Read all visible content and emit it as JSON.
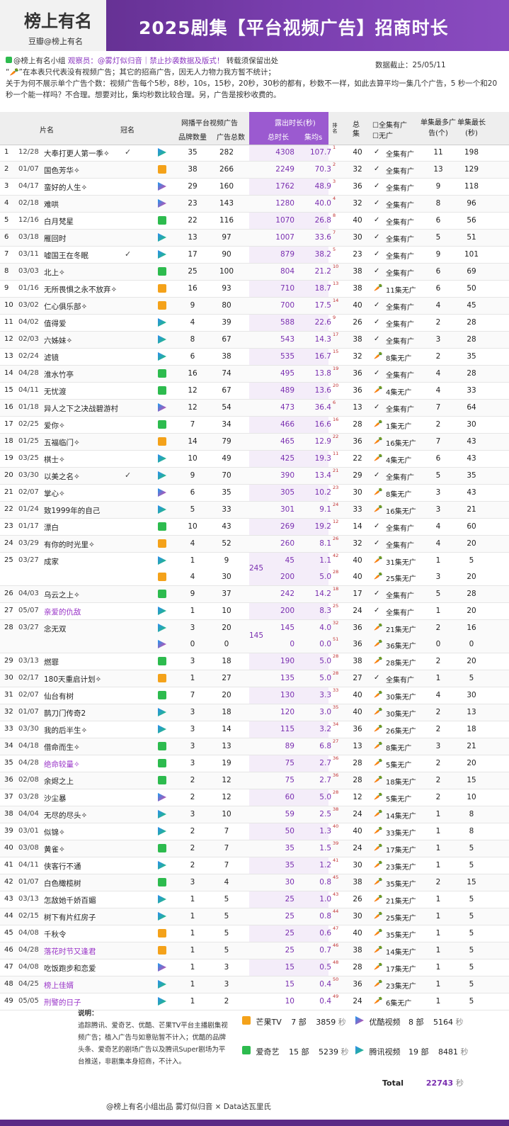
{
  "header": {
    "logo_text": "榜上有名",
    "logo_sub": "豆瓣@榜上有名",
    "title": "2025剧集【平台视频广告】招商时长"
  },
  "notes": {
    "line1_prefix": "@榜上有名小组",
    "line1_observer": "观察员：@雾灯似归音｜禁止抄袭数据及版式！",
    "line1_suffix": "转载须保留出处",
    "line2": "“🥕”在本表只代表没有视频广告；其它的招商广告，因无人力物力我方暂不统计；",
    "line3": "关于为何不展示单个广告个数：视频广告每个5秒，8秒，10s，15秒，20秒，30秒的都有，秒数不一样，如此去算平均一集几个广告，5 秒一个和20秒一个能一样吗？不合理。想要对比，集均秒数比较合理。另，广告是按秒收费的。",
    "date": "数据截止：25/05/11"
  },
  "table_header": {
    "name": "片名",
    "crown": "冠名",
    "platform_group": "网播平台视频广告",
    "brand_count": "品牌数量",
    "ad_total": "广告总数",
    "exposure_group": "露出时长(秒)",
    "total_len": "总时长",
    "avg_len": "集均s",
    "rank": "排名",
    "episodes": "总集",
    "full_ad": "☐全集有广",
    "no_ad": "☐无广",
    "max_per_ep": "单集最多广告(个)",
    "max_len": "单集最长(秒)"
  },
  "rows": [
    {
      "no": "1",
      "date": "12/28",
      "name": "大奉打更人第一季✧",
      "crown": "✓",
      "plat": "tencent",
      "brand": "35",
      "ads": "282",
      "total": "4308",
      "avg": "107.7",
      "rank": "1",
      "ep": "40",
      "chk": "✓",
      "status": "全集有广",
      "max": "11",
      "len": "198",
      "pur": false
    },
    {
      "no": "2",
      "date": "01/07",
      "name": "国色芳华✧",
      "crown": "",
      "plat": "mango",
      "brand": "38",
      "ads": "266",
      "total": "2249",
      "avg": "70.3",
      "rank": "2",
      "ep": "32",
      "chk": "✓",
      "status": "全集有广",
      "max": "13",
      "len": "129",
      "pur": false
    },
    {
      "no": "3",
      "date": "04/17",
      "name": "蛮好的人生✧",
      "crown": "",
      "plat": "youku",
      "brand": "29",
      "ads": "160",
      "total": "1762",
      "avg": "48.9",
      "rank": "3",
      "ep": "36",
      "chk": "✓",
      "status": "全集有广",
      "max": "9",
      "len": "118",
      "pur": false
    },
    {
      "no": "4",
      "date": "02/18",
      "name": "难哄",
      "crown": "",
      "plat": "youku",
      "brand": "23",
      "ads": "143",
      "total": "1280",
      "avg": "40.0",
      "rank": "4",
      "ep": "32",
      "chk": "✓",
      "status": "全集有广",
      "max": "8",
      "len": "96",
      "pur": false
    },
    {
      "no": "5",
      "date": "12/16",
      "name": "白月梵星",
      "crown": "",
      "plat": "iqiyi",
      "brand": "22",
      "ads": "116",
      "total": "1070",
      "avg": "26.8",
      "rank": "8",
      "ep": "40",
      "chk": "✓",
      "status": "全集有广",
      "max": "6",
      "len": "56",
      "pur": false
    },
    {
      "no": "6",
      "date": "03/18",
      "name": "雁回时",
      "crown": "",
      "plat": "tencent",
      "brand": "13",
      "ads": "97",
      "total": "1007",
      "avg": "33.6",
      "rank": "7",
      "ep": "30",
      "chk": "✓",
      "status": "全集有广",
      "max": "5",
      "len": "51",
      "pur": false
    },
    {
      "no": "7",
      "date": "03/11",
      "name": "嘘国王在冬眠",
      "crown": "✓",
      "plat": "tencent",
      "brand": "17",
      "ads": "90",
      "total": "879",
      "avg": "38.2",
      "rank": "5",
      "ep": "23",
      "chk": "✓",
      "status": "全集有广",
      "max": "9",
      "len": "101",
      "pur": false
    },
    {
      "no": "8",
      "date": "03/03",
      "name": "北上✧",
      "crown": "",
      "plat": "iqiyi",
      "brand": "25",
      "ads": "100",
      "total": "804",
      "avg": "21.2",
      "rank": "10",
      "ep": "38",
      "chk": "✓",
      "status": "全集有广",
      "max": "6",
      "len": "69",
      "pur": false
    },
    {
      "no": "9",
      "date": "01/16",
      "name": "无所畏惧之永不放弃✧",
      "crown": "",
      "plat": "mango",
      "brand": "16",
      "ads": "93",
      "total": "710",
      "avg": "18.7",
      "rank": "13",
      "ep": "38",
      "chk": "🥕",
      "status": "11集无广",
      "max": "6",
      "len": "50",
      "pur": false
    },
    {
      "no": "10",
      "date": "03/02",
      "name": "仁心俱乐部✧",
      "crown": "",
      "plat": "mango",
      "brand": "9",
      "ads": "80",
      "total": "700",
      "avg": "17.5",
      "rank": "14",
      "ep": "40",
      "chk": "✓",
      "status": "全集有广",
      "max": "4",
      "len": "45",
      "pur": false
    },
    {
      "no": "11",
      "date": "04/02",
      "name": "值得爱",
      "crown": "",
      "plat": "tencent",
      "brand": "4",
      "ads": "39",
      "total": "588",
      "avg": "22.6",
      "rank": "9",
      "ep": "26",
      "chk": "✓",
      "status": "全集有广",
      "max": "2",
      "len": "28",
      "pur": false
    },
    {
      "no": "12",
      "date": "02/03",
      "name": "六姊妹✧",
      "crown": "",
      "plat": "tencent",
      "brand": "8",
      "ads": "67",
      "total": "543",
      "avg": "14.3",
      "rank": "17",
      "ep": "38",
      "chk": "✓",
      "status": "全集有广",
      "max": "3",
      "len": "28",
      "pur": false
    },
    {
      "no": "13",
      "date": "02/24",
      "name": "滤镜",
      "crown": "",
      "plat": "tencent",
      "brand": "6",
      "ads": "38",
      "total": "535",
      "avg": "16.7",
      "rank": "15",
      "ep": "32",
      "chk": "🥕",
      "status": "8集无广",
      "max": "2",
      "len": "35",
      "pur": false
    },
    {
      "no": "14",
      "date": "04/28",
      "name": "淮水竹亭",
      "crown": "",
      "plat": "iqiyi",
      "brand": "16",
      "ads": "74",
      "total": "495",
      "avg": "13.8",
      "rank": "19",
      "ep": "36",
      "chk": "✓",
      "status": "全集有广",
      "max": "4",
      "len": "28",
      "pur": false
    },
    {
      "no": "15",
      "date": "04/11",
      "name": "无忧渡",
      "crown": "",
      "plat": "iqiyi",
      "brand": "12",
      "ads": "67",
      "total": "489",
      "avg": "13.6",
      "rank": "20",
      "ep": "36",
      "chk": "🥕",
      "status": "4集无广",
      "max": "4",
      "len": "33",
      "pur": false
    },
    {
      "no": "16",
      "date": "01/18",
      "name": "异人之下之决战碧游村",
      "crown": "",
      "plat": "youku",
      "brand": "12",
      "ads": "54",
      "total": "473",
      "avg": "36.4",
      "rank": "6",
      "ep": "13",
      "chk": "✓",
      "status": "全集有广",
      "max": "7",
      "len": "64",
      "pur": false
    },
    {
      "no": "17",
      "date": "02/25",
      "name": "爱你✧",
      "crown": "",
      "plat": "iqiyi",
      "brand": "7",
      "ads": "34",
      "total": "466",
      "avg": "16.6",
      "rank": "16",
      "ep": "28",
      "chk": "🥕",
      "status": "1集无广",
      "max": "2",
      "len": "30",
      "pur": false
    },
    {
      "no": "18",
      "date": "01/25",
      "name": "五福临门✧",
      "crown": "",
      "plat": "mango",
      "brand": "14",
      "ads": "79",
      "total": "465",
      "avg": "12.9",
      "rank": "22",
      "ep": "36",
      "chk": "🥕",
      "status": "16集无广",
      "max": "7",
      "len": "43",
      "pur": false
    },
    {
      "no": "19",
      "date": "03/25",
      "name": "棋士✧",
      "crown": "",
      "plat": "tencent",
      "brand": "10",
      "ads": "49",
      "total": "425",
      "avg": "19.3",
      "rank": "11",
      "ep": "22",
      "chk": "🥕",
      "status": "4集无广",
      "max": "6",
      "len": "43",
      "pur": false
    },
    {
      "no": "20",
      "date": "03/30",
      "name": "以美之名✧",
      "crown": "✓",
      "plat": "tencent",
      "brand": "9",
      "ads": "70",
      "total": "390",
      "avg": "13.4",
      "rank": "21",
      "ep": "29",
      "chk": "✓",
      "status": "全集有广",
      "max": "5",
      "len": "35",
      "pur": false
    },
    {
      "no": "21",
      "date": "02/07",
      "name": "掌心✧",
      "crown": "",
      "plat": "youku",
      "brand": "6",
      "ads": "35",
      "total": "305",
      "avg": "10.2",
      "rank": "23",
      "ep": "30",
      "chk": "🥕",
      "status": "8集无广",
      "max": "3",
      "len": "43",
      "pur": false
    },
    {
      "no": "22",
      "date": "01/24",
      "name": "致1999年的自己",
      "crown": "",
      "plat": "tencent",
      "brand": "5",
      "ads": "33",
      "total": "301",
      "avg": "9.1",
      "rank": "24",
      "ep": "33",
      "chk": "🥕",
      "status": "16集无广",
      "max": "3",
      "len": "21",
      "pur": false
    },
    {
      "no": "23",
      "date": "01/17",
      "name": "漂白",
      "crown": "",
      "plat": "iqiyi",
      "brand": "10",
      "ads": "43",
      "total": "269",
      "avg": "19.2",
      "rank": "12",
      "ep": "14",
      "chk": "✓",
      "status": "全集有广",
      "max": "4",
      "len": "60",
      "pur": false
    },
    {
      "no": "24",
      "date": "03/29",
      "name": "有你的时光里✧",
      "crown": "",
      "plat": "mango",
      "brand": "4",
      "ads": "52",
      "total": "260",
      "avg": "8.1",
      "rank": "26",
      "ep": "32",
      "chk": "✓",
      "status": "全集有广",
      "max": "4",
      "len": "20",
      "pur": false
    }
  ],
  "row25": {
    "no": "25",
    "date": "03/27",
    "name": "成家",
    "combined": "245",
    "a": {
      "plat": "tencent",
      "brand": "1",
      "ads": "9",
      "total": "45",
      "avg": "1.1",
      "rank": "42",
      "ep": "40",
      "chk": "🥕",
      "status": "31集无广",
      "max": "1",
      "len": "5"
    },
    "b": {
      "plat": "mango",
      "brand": "4",
      "ads": "30",
      "total": "200",
      "avg": "5.0",
      "rank": "28",
      "ep": "40",
      "chk": "🥕",
      "status": "25集无广",
      "max": "3",
      "len": "20"
    }
  },
  "rows2": [
    {
      "no": "26",
      "date": "04/03",
      "name": "乌云之上✧",
      "crown": "",
      "plat": "iqiyi",
      "brand": "9",
      "ads": "37",
      "total": "242",
      "avg": "14.2",
      "rank": "18",
      "ep": "17",
      "chk": "✓",
      "status": "全集有广",
      "max": "5",
      "len": "28",
      "pur": false
    },
    {
      "no": "27",
      "date": "05/07",
      "name": "亲爱的仇敌",
      "crown": "",
      "plat": "tencent",
      "brand": "1",
      "ads": "10",
      "total": "200",
      "avg": "8.3",
      "rank": "25",
      "ep": "24",
      "chk": "✓",
      "status": "全集有广",
      "max": "1",
      "len": "20",
      "pur": true
    }
  ],
  "row28": {
    "no": "28",
    "date": "03/27",
    "name": "念无双",
    "combined": "145",
    "a": {
      "plat": "tencent",
      "brand": "3",
      "ads": "20",
      "total": "145",
      "avg": "4.0",
      "rank": "32",
      "ep": "36",
      "chk": "🥕",
      "status": "21集无广",
      "max": "2",
      "len": "16"
    },
    "b": {
      "plat": "youku",
      "brand": "0",
      "ads": "0",
      "total": "0",
      "avg": "0.0",
      "rank": "51",
      "ep": "36",
      "chk": "🥕",
      "status": "36集无广",
      "max": "0",
      "len": "0"
    }
  },
  "rows3": [
    {
      "no": "29",
      "date": "03/13",
      "name": "燃罪",
      "crown": "",
      "plat": "iqiyi",
      "brand": "3",
      "ads": "18",
      "total": "190",
      "avg": "5.0",
      "rank": "28",
      "ep": "38",
      "chk": "🥕",
      "status": "28集无广",
      "max": "2",
      "len": "20",
      "pur": false
    },
    {
      "no": "30",
      "date": "02/17",
      "name": "180天重启计划✧",
      "crown": "",
      "plat": "mango",
      "brand": "1",
      "ads": "27",
      "total": "135",
      "avg": "5.0",
      "rank": "28",
      "ep": "27",
      "chk": "✓",
      "status": "全集有广",
      "max": "1",
      "len": "5",
      "pur": false
    },
    {
      "no": "31",
      "date": "02/07",
      "name": "仙台有树",
      "crown": "",
      "plat": "iqiyi",
      "brand": "7",
      "ads": "20",
      "total": "130",
      "avg": "3.3",
      "rank": "33",
      "ep": "40",
      "chk": "🥕",
      "status": "30集无广",
      "max": "4",
      "len": "30",
      "pur": false
    },
    {
      "no": "32",
      "date": "01/07",
      "name": "鹊刀门传奇2",
      "crown": "",
      "plat": "tencent",
      "brand": "3",
      "ads": "18",
      "total": "120",
      "avg": "3.0",
      "rank": "35",
      "ep": "40",
      "chk": "🥕",
      "status": "30集无广",
      "max": "2",
      "len": "13",
      "pur": false
    },
    {
      "no": "33",
      "date": "03/30",
      "name": "我的后半生✧",
      "crown": "",
      "plat": "tencent",
      "brand": "3",
      "ads": "14",
      "total": "115",
      "avg": "3.2",
      "rank": "34",
      "ep": "36",
      "chk": "🥕",
      "status": "26集无广",
      "max": "2",
      "len": "18",
      "pur": false
    },
    {
      "no": "34",
      "date": "04/18",
      "name": "借命而生✧",
      "crown": "",
      "plat": "iqiyi",
      "brand": "3",
      "ads": "13",
      "total": "89",
      "avg": "6.8",
      "rank": "27",
      "ep": "13",
      "chk": "🥕",
      "status": "8集无广",
      "max": "3",
      "len": "21",
      "pur": false
    },
    {
      "no": "35",
      "date": "04/28",
      "name": "绝命较量✧",
      "crown": "",
      "plat": "iqiyi",
      "brand": "3",
      "ads": "19",
      "total": "75",
      "avg": "2.7",
      "rank": "36",
      "ep": "28",
      "chk": "🥕",
      "status": "5集无广",
      "max": "2",
      "len": "20",
      "pur": true
    },
    {
      "no": "36",
      "date": "02/08",
      "name": "余烬之上",
      "crown": "",
      "plat": "iqiyi",
      "brand": "2",
      "ads": "12",
      "total": "75",
      "avg": "2.7",
      "rank": "36",
      "ep": "28",
      "chk": "🥕",
      "status": "18集无广",
      "max": "2",
      "len": "15",
      "pur": false
    },
    {
      "no": "37",
      "date": "03/28",
      "name": "沙尘暴",
      "crown": "",
      "plat": "youku",
      "brand": "2",
      "ads": "12",
      "total": "60",
      "avg": "5.0",
      "rank": "28",
      "ep": "12",
      "chk": "🥕",
      "status": "5集无广",
      "max": "2",
      "len": "10",
      "pur": false
    },
    {
      "no": "38",
      "date": "04/04",
      "name": "无尽的尽头✧",
      "crown": "",
      "plat": "tencent",
      "brand": "3",
      "ads": "10",
      "total": "59",
      "avg": "2.5",
      "rank": "38",
      "ep": "24",
      "chk": "🥕",
      "status": "14集无广",
      "max": "1",
      "len": "8",
      "pur": false
    },
    {
      "no": "39",
      "date": "03/01",
      "name": "似锦✧",
      "crown": "",
      "plat": "tencent",
      "brand": "2",
      "ads": "7",
      "total": "50",
      "avg": "1.3",
      "rank": "40",
      "ep": "40",
      "chk": "🥕",
      "status": "33集无广",
      "max": "1",
      "len": "8",
      "pur": false
    },
    {
      "no": "40",
      "date": "03/08",
      "name": "黄雀✧",
      "crown": "",
      "plat": "iqiyi",
      "brand": "2",
      "ads": "7",
      "total": "35",
      "avg": "1.5",
      "rank": "39",
      "ep": "24",
      "chk": "🥕",
      "status": "17集无广",
      "max": "1",
      "len": "5",
      "pur": false
    },
    {
      "no": "41",
      "date": "04/11",
      "name": "侠客行不通",
      "crown": "",
      "plat": "tencent",
      "brand": "2",
      "ads": "7",
      "total": "35",
      "avg": "1.2",
      "rank": "41",
      "ep": "30",
      "chk": "🥕",
      "status": "23集无广",
      "max": "1",
      "len": "5",
      "pur": false
    },
    {
      "no": "42",
      "date": "01/07",
      "name": "白色橄榄树",
      "crown": "",
      "plat": "iqiyi",
      "brand": "3",
      "ads": "4",
      "total": "30",
      "avg": "0.8",
      "rank": "45",
      "ep": "38",
      "chk": "🥕",
      "status": "35集无广",
      "max": "2",
      "len": "15",
      "pur": false
    },
    {
      "no": "43",
      "date": "03/13",
      "name": "怎敌她千娇百媚",
      "crown": "",
      "plat": "tencent",
      "brand": "1",
      "ads": "5",
      "total": "25",
      "avg": "1.0",
      "rank": "43",
      "ep": "26",
      "chk": "🥕",
      "status": "21集无广",
      "max": "1",
      "len": "5",
      "pur": false
    },
    {
      "no": "44",
      "date": "02/15",
      "name": "树下有片红房子",
      "crown": "",
      "plat": "tencent",
      "brand": "1",
      "ads": "5",
      "total": "25",
      "avg": "0.8",
      "rank": "44",
      "ep": "30",
      "chk": "🥕",
      "status": "25集无广",
      "max": "1",
      "len": "5",
      "pur": false
    },
    {
      "no": "45",
      "date": "04/08",
      "name": "千秋令",
      "crown": "",
      "plat": "mango",
      "brand": "1",
      "ads": "5",
      "total": "25",
      "avg": "0.6",
      "rank": "47",
      "ep": "40",
      "chk": "🥕",
      "status": "35集无广",
      "max": "1",
      "len": "5",
      "pur": false
    },
    {
      "no": "46",
      "date": "04/28",
      "name": "落花时节又逢君",
      "crown": "",
      "plat": "mango",
      "brand": "1",
      "ads": "5",
      "total": "25",
      "avg": "0.7",
      "rank": "46",
      "ep": "38",
      "chk": "🥕",
      "status": "14集无广",
      "max": "1",
      "len": "5",
      "pur": true
    },
    {
      "no": "47",
      "date": "04/08",
      "name": "吃饭跑步和恋爱",
      "crown": "",
      "plat": "youku",
      "brand": "1",
      "ads": "3",
      "total": "15",
      "avg": "0.5",
      "rank": "48",
      "ep": "28",
      "chk": "🥕",
      "status": "17集无广",
      "max": "1",
      "len": "5",
      "pur": false
    },
    {
      "no": "48",
      "date": "04/25",
      "name": "榜上佳婿",
      "crown": "",
      "plat": "tencent",
      "brand": "1",
      "ads": "3",
      "total": "15",
      "avg": "0.4",
      "rank": "50",
      "ep": "36",
      "chk": "🥕",
      "status": "23集无广",
      "max": "1",
      "len": "5",
      "pur": true
    },
    {
      "no": "49",
      "date": "05/05",
      "name": "刑警的日子",
      "crown": "",
      "plat": "tencent",
      "brand": "1",
      "ads": "2",
      "total": "10",
      "avg": "0.4",
      "rank": "49",
      "ep": "24",
      "chk": "🥕",
      "status": "6集无广",
      "max": "1",
      "len": "5",
      "pur": true
    }
  ],
  "summary": {
    "expl_title": "说明：",
    "expl_text": "追踪腾讯、爱奇艺、优酷、芒果TV平台主播剧集视频广告；植入广告与如意贴暂不计入；优酷的品牌头条、爱奇艺的剧场广告以及腾讯Super剧场为平台推送，非剧集本身招商，不计入。",
    "mango": {
      "name": "芒果TV",
      "count": "7 部",
      "secs": "3859",
      "unit": "秒"
    },
    "youku": {
      "name": "优酷视频",
      "count": "8 部",
      "secs": "5164",
      "unit": "秒"
    },
    "iqiyi": {
      "name": "爱奇艺",
      "count": "15 部",
      "secs": "5239",
      "unit": "秒"
    },
    "tencent": {
      "name": "腾讯视频",
      "count": "19 部",
      "secs": "8481",
      "unit": "秒"
    },
    "total_label": "Total",
    "total_secs": "22743",
    "total_unit": "秒"
  },
  "footer": {
    "text": "@榜上有名小组出品  雾灯似归音 × Data达瓦里氏"
  }
}
